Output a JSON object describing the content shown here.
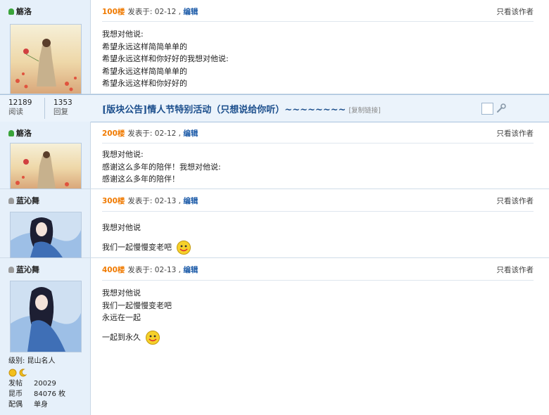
{
  "colors": {
    "floor": "#f07a00",
    "edit": "#1b5aa8",
    "title": "#1b4e8c",
    "sidebar": "#e6f0fa"
  },
  "posts": [
    {
      "user": "觞洛",
      "floor": "100楼",
      "posted": "发表于: 02-12 ,",
      "edit": "编辑",
      "only_author": "只看该作者",
      "lines": [
        "我想对他说:",
        "希望永远这样简简单单的",
        "希望永远这样和你好好的我想对他说:",
        "希望永远这样简简单单的",
        "希望永远这样和你好好的"
      ]
    },
    {
      "user": "觞洛",
      "floor": "200楼",
      "posted": "发表于: 02-12 ,",
      "edit": "编辑",
      "only_author": "只看该作者",
      "lines": [
        "我想对他说:",
        "感谢这么多年的陪伴！我想对他说:",
        "感谢这么多年的陪伴！"
      ]
    },
    {
      "user": "蓝沁舞",
      "floor": "300楼",
      "posted": "发表于: 02-13 ,",
      "edit": "编辑",
      "only_author": "只看该作者",
      "lines": [
        "我想对他说",
        "我们一起慢慢变老吧"
      ]
    },
    {
      "user": "蓝沁舞",
      "floor": "400楼",
      "posted": "发表于: 02-13 ,",
      "edit": "编辑",
      "only_author": "只看该作者",
      "lines": [
        "我想对他说",
        "我们一起慢慢变老吧",
        "永远在一起",
        "一起到永久"
      ]
    }
  ],
  "thread": {
    "reads": "12189",
    "reads_label": "阅读",
    "replies": "1353",
    "replies_label": "回复",
    "title": "[版块公告]情人节特别活动（只想说给你听）~~~~~~~~",
    "copy_link": "[复制链接]"
  },
  "profile": {
    "level_label": "级别: 昆山名人",
    "posts_label": "发帖",
    "posts": "20029",
    "coins_label": "昆币",
    "coins": "84076 枚",
    "spouse_label": "配偶",
    "spouse": "单身"
  }
}
